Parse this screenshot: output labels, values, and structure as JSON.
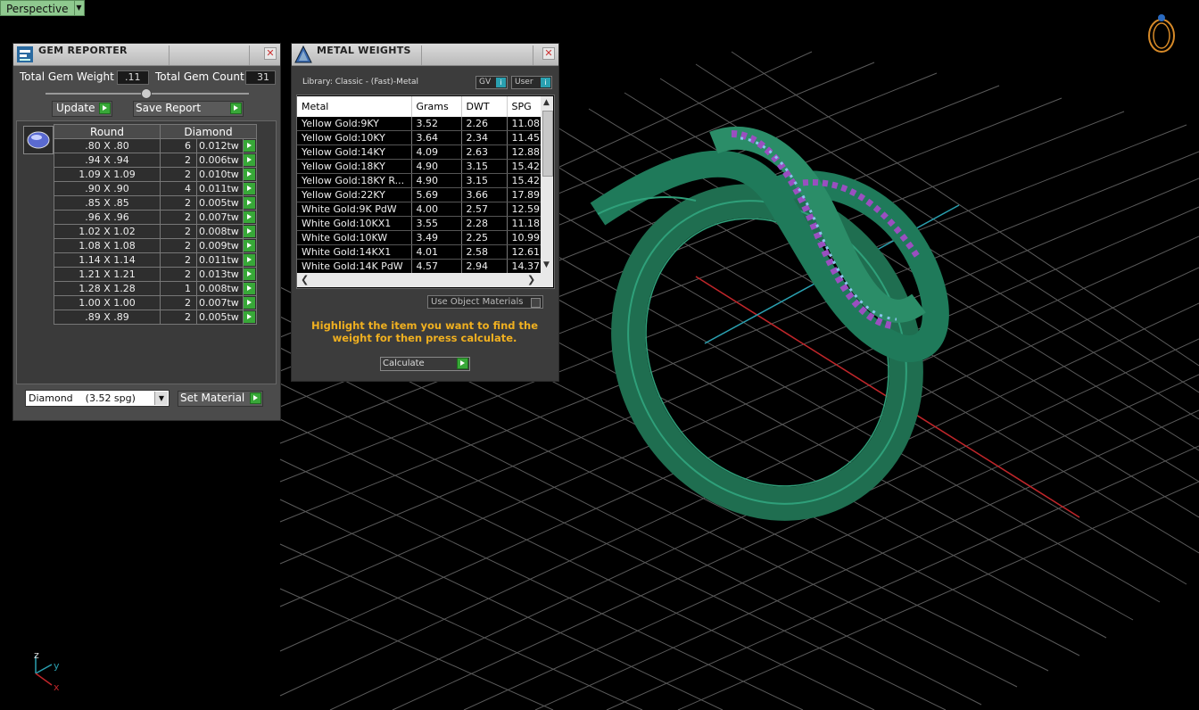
{
  "viewport": {
    "label": "Perspective",
    "axes": {
      "z": "z",
      "y": "y",
      "x": "x"
    }
  },
  "gem_reporter": {
    "title": "GEM REPORTER",
    "total_weight_label": "Total Gem Weight",
    "total_weight_value": ".11",
    "total_count_label": "Total Gem Count",
    "total_count_value": "31",
    "update_label": "Update",
    "save_report_label": "Save Report",
    "col_shape": "Round",
    "col_material": "Diamond",
    "rows": [
      {
        "size": ".80 X .80",
        "count": "6",
        "tw": "0.012tw"
      },
      {
        "size": ".94 X .94",
        "count": "2",
        "tw": "0.006tw"
      },
      {
        "size": "1.09 X 1.09",
        "count": "2",
        "tw": "0.010tw"
      },
      {
        "size": ".90 X .90",
        "count": "4",
        "tw": "0.011tw"
      },
      {
        "size": ".85 X .85",
        "count": "2",
        "tw": "0.005tw"
      },
      {
        "size": ".96 X .96",
        "count": "2",
        "tw": "0.007tw"
      },
      {
        "size": "1.02 X 1.02",
        "count": "2",
        "tw": "0.008tw"
      },
      {
        "size": "1.08 X 1.08",
        "count": "2",
        "tw": "0.009tw"
      },
      {
        "size": "1.14 X 1.14",
        "count": "2",
        "tw": "0.011tw"
      },
      {
        "size": "1.21 X 1.21",
        "count": "2",
        "tw": "0.013tw"
      },
      {
        "size": "1.28 X 1.28",
        "count": "1",
        "tw": "0.008tw"
      },
      {
        "size": "1.00 X 1.00",
        "count": "2",
        "tw": "0.007tw"
      },
      {
        "size": ".89 X .89",
        "count": "2",
        "tw": "0.005tw"
      }
    ],
    "material_select": "Diamond    (3.52 spg)",
    "set_material_label": "Set Material"
  },
  "metal_weights": {
    "title": "METAL WEIGHTS",
    "library_label": "Library: Classic - (Fast)-Metal",
    "gv_label": "GV",
    "user_label": "User",
    "columns": [
      "Metal",
      "Grams",
      "DWT",
      "SPG"
    ],
    "rows": [
      [
        "Yellow Gold:9KY",
        "3.52",
        "2.26",
        "11.08"
      ],
      [
        "Yellow Gold:10KY",
        "3.64",
        "2.34",
        "11.45"
      ],
      [
        "Yellow Gold:14KY",
        "4.09",
        "2.63",
        "12.88"
      ],
      [
        "Yellow Gold:18KY",
        "4.90",
        "3.15",
        "15.42"
      ],
      [
        "Yellow Gold:18KY R...",
        "4.90",
        "3.15",
        "15.42"
      ],
      [
        "Yellow Gold:22KY",
        "5.69",
        "3.66",
        "17.89"
      ],
      [
        "White Gold:9K PdW",
        "4.00",
        "2.57",
        "12.59"
      ],
      [
        "White Gold:10KX1",
        "3.55",
        "2.28",
        "11.18"
      ],
      [
        "White Gold:10KW",
        "3.49",
        "2.25",
        "10.99"
      ],
      [
        "White Gold:14KX1",
        "4.01",
        "2.58",
        "12.61"
      ],
      [
        "White Gold:14K PdW",
        "4.57",
        "2.94",
        "14.37"
      ]
    ],
    "use_object_materials_label": "Use Object Materials",
    "instruction": "Highlight the item you want to find the weight for then press calculate.",
    "calculate_label": "Calculate"
  },
  "colors": {
    "ring": "#1f7a5a",
    "gem_purple": "#9a4fc0",
    "gem_blue": "#8ac4ee",
    "grid": "#5a5a5a",
    "axis_x": "#c0262a",
    "axis_y": "#2aa0b0",
    "instruction_text": "#f0b020",
    "go_button": "#38a838"
  }
}
